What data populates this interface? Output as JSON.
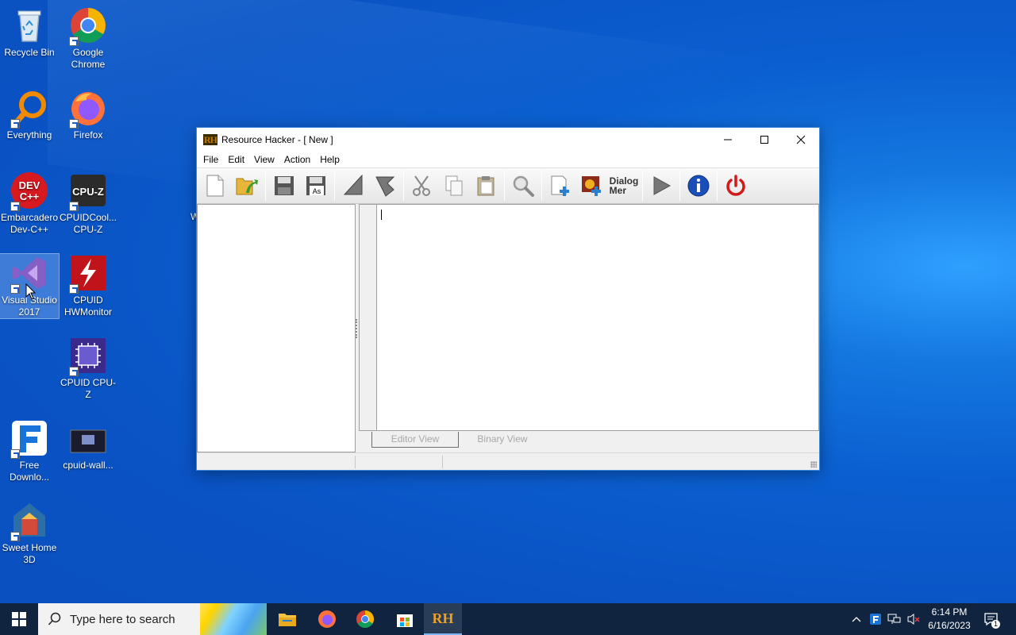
{
  "desktop": {
    "icons": [
      {
        "label": "Recycle Bin"
      },
      {
        "label": "Google Chrome"
      },
      {
        "label": "Everything"
      },
      {
        "label": "Firefox"
      },
      {
        "label": "Embarcadero Dev-C++"
      },
      {
        "label": "CPUIDCool... CPU-Z"
      },
      {
        "label": "Visual Studio 2017"
      },
      {
        "label": "CPUID HWMonitor"
      },
      {
        "label": "CPUID CPU-Z"
      },
      {
        "label": "Free Downlo..."
      },
      {
        "label": "cpuid-wall..."
      },
      {
        "label": "Sweet Home 3D"
      }
    ],
    "stray_text": "W"
  },
  "window": {
    "icon_text": "RH",
    "title": "Resource Hacker - [ New ]",
    "menu": [
      "File",
      "Edit",
      "View",
      "Action",
      "Help"
    ],
    "toolbar": {
      "dialog_label_line1": "Dialog",
      "dialog_label_line2": "Mer"
    },
    "tabs": {
      "editor": "Editor View",
      "binary": "Binary View"
    }
  },
  "taskbar": {
    "search_placeholder": "Type here to search",
    "time": "6:14 PM",
    "date": "6/16/2023",
    "notification_count": "1",
    "active_app_text": "RH"
  },
  "colors": {
    "desktop": "#0a58c8",
    "taskbar": "#10243f",
    "window_border": "#3a88d8"
  }
}
